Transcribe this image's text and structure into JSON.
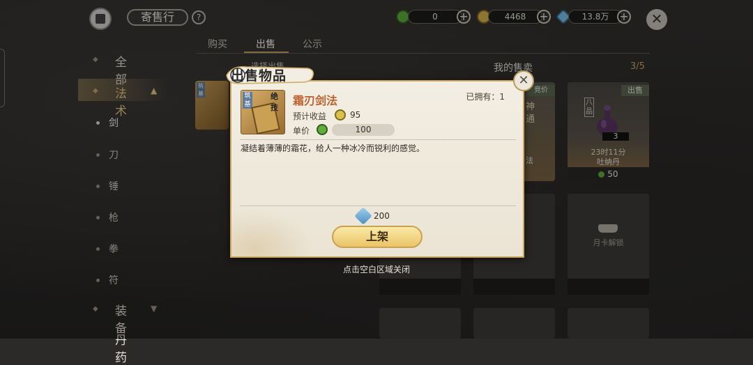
{
  "header": {
    "title": "寄售行",
    "help": "?",
    "currencies": [
      {
        "name": "green-coin",
        "value": "0",
        "color": "#5fae3d"
      },
      {
        "name": "gold-coin",
        "value": "4468",
        "color": "#d9b64a"
      },
      {
        "name": "blue-crystal",
        "value": "13.8万",
        "color": "#7cc0e8"
      }
    ],
    "close": "✕"
  },
  "tabs": [
    {
      "label": "购买",
      "active": false
    },
    {
      "label": "出售",
      "active": true
    },
    {
      "label": "公示",
      "active": false
    }
  ],
  "sidebar": {
    "all": "全部",
    "category_active": "法术",
    "sub_items": [
      "剑",
      "刀",
      "锤",
      "枪",
      "拳",
      "符"
    ],
    "category_next": "装备",
    "category_partial": "丹药"
  },
  "my_sale": {
    "label": "我的售卖",
    "count": "3/5",
    "left_header_partial": "选择出售",
    "card": {
      "tag": "出售",
      "grade": "八品",
      "qty": "3",
      "time": "23时11分",
      "name": "吐纳丹",
      "price": "50"
    },
    "card2_tag": "竞价",
    "card2_text": [
      "神",
      "通",
      "法"
    ],
    "lock_label": "月卡解锁"
  },
  "modal": {
    "title": "出售物品",
    "item_name": "霜刃剑法",
    "item_grade": "筑基",
    "item_tag": "绝技",
    "owned_label": "已拥有：1",
    "est_label": "预计收益",
    "est_value": "95",
    "price_label": "单价",
    "price_value": "100",
    "description": "凝结着薄薄的霜花，给人一种冰冷而锐利的感觉。",
    "fee_value": "200",
    "list_button": "上架",
    "close": "✕"
  },
  "hint": "点击空白区域关闭",
  "colors": {
    "accent_gold": "#c9a66b",
    "item_name": "#c0622f",
    "modal_bg": "#f3eee3"
  }
}
